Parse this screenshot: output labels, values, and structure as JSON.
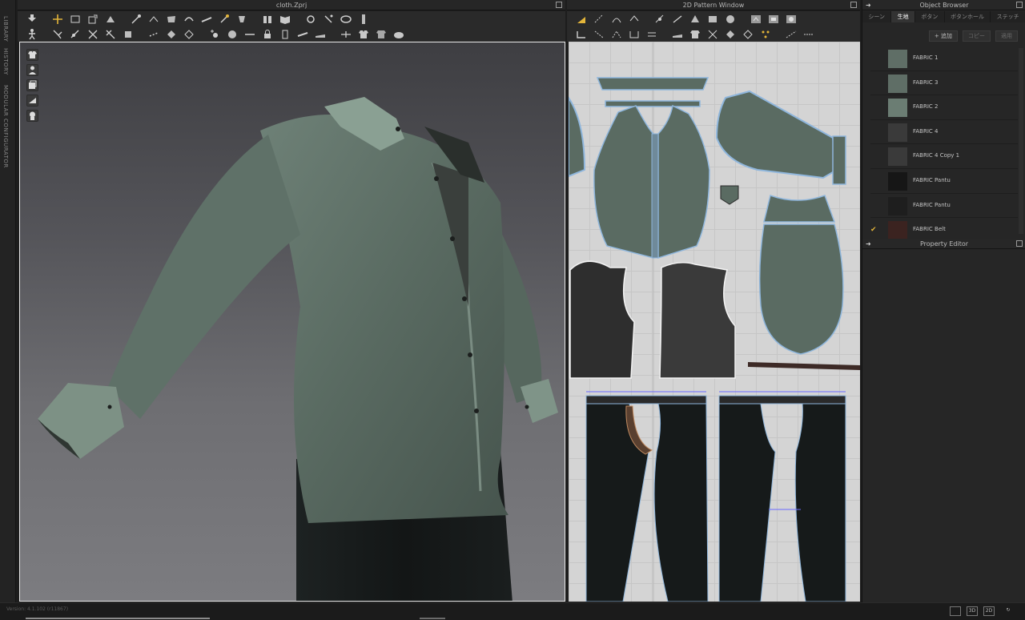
{
  "side_tabs": [
    "LIBRARY",
    "HISTORY",
    "MODULAR CONFIGURATOR"
  ],
  "window3d": {
    "title": "cloth.Zprj"
  },
  "window2d": {
    "title": "2D Pattern Window"
  },
  "object_browser": {
    "title": "Object Browser",
    "tabs": [
      "シーン",
      "生地",
      "ボタン",
      "ボタンホール",
      "ステッチ"
    ],
    "active_tab": "生地",
    "actions": {
      "add": "+ 追加",
      "copy": "コピー",
      "apply": "適用"
    },
    "fabrics": [
      {
        "name": "FABRIC 1",
        "color": "#5f6e66",
        "checked": ""
      },
      {
        "name": "FABRIC 3",
        "color": "#5f6e66",
        "checked": ""
      },
      {
        "name": "FABRIC 2",
        "color": "#6b7d73",
        "checked": ""
      },
      {
        "name": "FABRIC 4",
        "color": "#3a3a3a",
        "checked": ""
      },
      {
        "name": "FABRIC 4 Copy 1",
        "color": "#3a3a3a",
        "checked": ""
      },
      {
        "name": "FABRIC Pantu",
        "color": "#161616",
        "checked": ""
      },
      {
        "name": "FABRIC Pantu",
        "color": "#1e1e1e",
        "checked": ""
      },
      {
        "name": "FABRIC Belt",
        "color": "#3b2320",
        "checked": "✔"
      }
    ]
  },
  "property_editor": {
    "title": "Property Editor"
  },
  "status": {
    "version": "Version: 4.1.102 (r11867)",
    "view_buttons": [
      "3D",
      "2D"
    ]
  },
  "colors": {
    "shirt": "#5a6b62",
    "pants": "#161a1a",
    "belt": "#3d2a26",
    "accent": "#e3b53a",
    "pattern_edge": "#8fb6dc"
  }
}
